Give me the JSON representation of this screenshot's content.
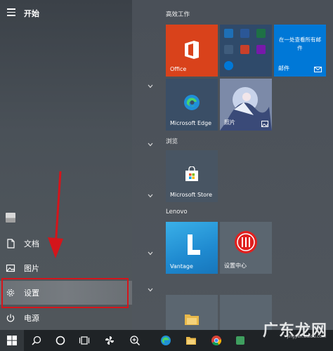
{
  "start_menu": {
    "title": "开始",
    "rail_items": [
      {
        "label": "文档",
        "icon": "document-icon"
      },
      {
        "label": "图片",
        "icon": "picture-icon"
      },
      {
        "label": "设置",
        "icon": "gear-icon"
      },
      {
        "label": "电源",
        "icon": "power-icon"
      }
    ]
  },
  "tiles": {
    "groups": [
      {
        "label": "高效工作"
      },
      {
        "label": "浏览"
      },
      {
        "label": "Lenovo"
      }
    ],
    "office": {
      "label": "Office"
    },
    "mail": {
      "label": "邮件",
      "message": "在一处查看所有邮件"
    },
    "edge": {
      "label": "Microsoft Edge"
    },
    "photos": {
      "label": "照片"
    },
    "store": {
      "label": "Microsoft Store"
    },
    "vantage": {
      "label": "Vantage"
    },
    "settings_center": {
      "label": "设置中心"
    }
  },
  "watermark": {
    "text": "广东龙网",
    "sub": "jingyan.baidu.com"
  },
  "colors": {
    "office": "#d9421b",
    "mail": "#0078d7",
    "highlight": "#d4151b",
    "taskbar": "#1f2326"
  }
}
